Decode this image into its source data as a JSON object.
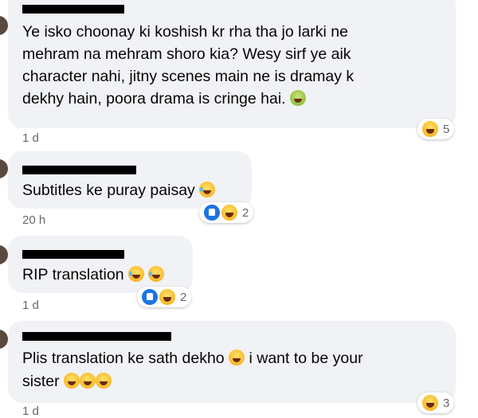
{
  "comments": [
    {
      "lines": [
        "Ye isko choonay ki koshish kr rha tha jo larki ne",
        "mehram na mehram shoro kia? Wesy sirf ye aik",
        "character nahi, jitny scenes main ne is dramay k",
        "dekhy hain, poora drama is cringe hai."
      ],
      "time": "1 d",
      "reaction_count": "5"
    },
    {
      "text": "Subtitles ke puray paisay",
      "time": "20 h",
      "reaction_count": "2"
    },
    {
      "text": "RIP translation",
      "time": "1 d",
      "reaction_count": "2"
    },
    {
      "line1": "Plis translation ke sath dekho",
      "line1b": "i want to be your",
      "line2": "sister",
      "time": "1 d",
      "reaction_count": "3"
    }
  ],
  "icons": {
    "like": "like-icon",
    "haha": "haha-emoji-icon",
    "sick": "sick-emoji-icon",
    "rofl": "rofl-emoji-icon",
    "crying": "crying-emoji-icon"
  },
  "colors": {
    "bubble": "#f0f2f5",
    "meta_text": "#65676b",
    "like_blue": "#1b74e4",
    "haha_yellow": "#f7b928"
  }
}
